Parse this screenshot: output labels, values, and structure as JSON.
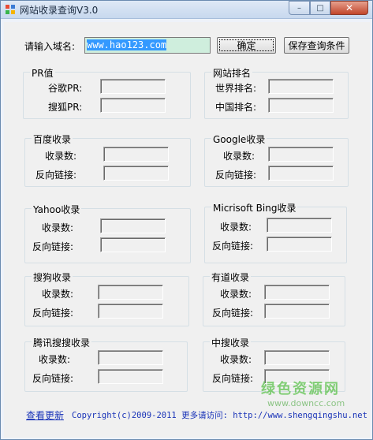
{
  "window": {
    "title": "网站收录查询V3.0",
    "min_glyph": "–",
    "max_glyph": "□",
    "close_glyph": "✕"
  },
  "query": {
    "label": "请输入域名:",
    "value": "www.hao123.com",
    "confirm_button": "确定",
    "save_button": "保存查询条件"
  },
  "groups": {
    "pr": {
      "title": "PR值",
      "row1": "谷歌PR:",
      "row2": "搜狐PR:"
    },
    "rank": {
      "title": "网站排名",
      "row1": "世界排名:",
      "row2": "中国排名:"
    },
    "baidu": {
      "title": "百度收录",
      "row1": "收录数:",
      "row2": "反向链接:"
    },
    "google": {
      "title": "Google收录",
      "row1": "收录数:",
      "row2": "反向链接:"
    },
    "yahoo": {
      "title": "Yahoo收录",
      "row1": "收录数:",
      "row2": "反向链接:"
    },
    "bing": {
      "title": "Micrisoft Bing收录",
      "row1": "收录数:",
      "row2": "反向链接:"
    },
    "sogou": {
      "title": "搜狗收录",
      "row1": "收录数:",
      "row2": "反向链接:"
    },
    "youdao": {
      "title": "有道收录",
      "row1": "收录数:",
      "row2": "反向链接:"
    },
    "tencent": {
      "title": "腾讯搜搜收录",
      "row1": "收录数:",
      "row2": "反向链接:"
    },
    "zhongsou": {
      "title": "中搜收录",
      "row1": "收录数:",
      "row2": "反向链接:"
    }
  },
  "footer": {
    "update_link": "查看更新",
    "copyright": "Copyright(c)2009-2011 更多请访问: http://www.shengqingshu.net"
  },
  "watermark": {
    "brand": "绿色资源网",
    "site": "www.downcc.com"
  },
  "colors": {
    "link": "#1a34b8",
    "selection": "#3399ff",
    "input_bg": "#cfeedd"
  }
}
